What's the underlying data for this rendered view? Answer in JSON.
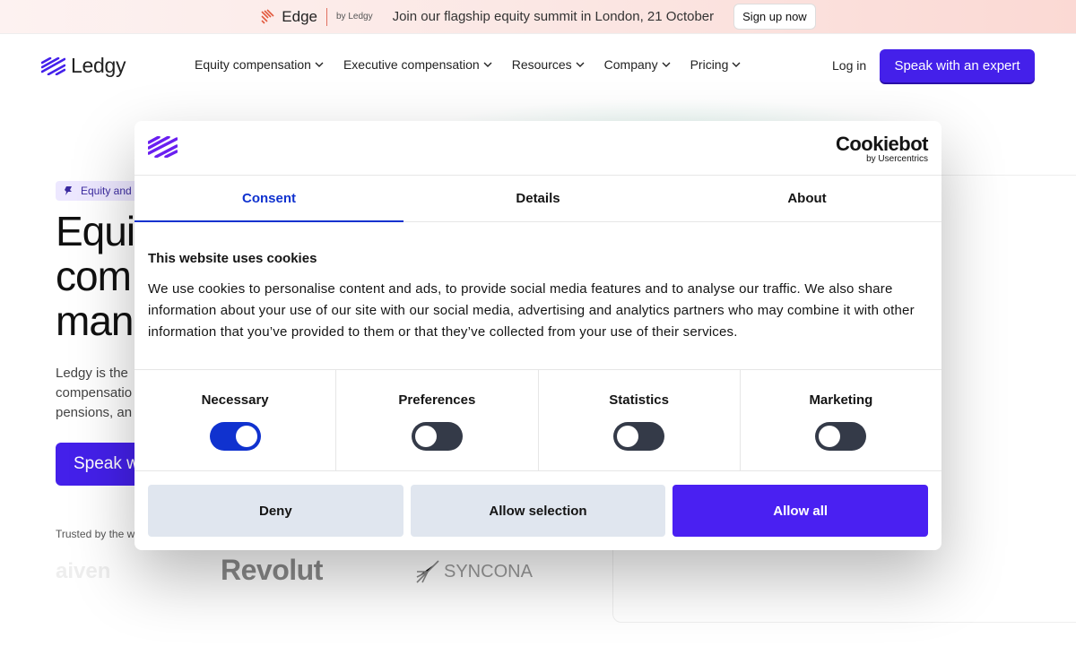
{
  "banner": {
    "edge_word": "Edge",
    "edge_by": "by Ledgy",
    "text": "Join our flagship equity summit in London, 21 October",
    "button": "Sign up now"
  },
  "nav": {
    "logo": "Ledgy",
    "items": [
      "Equity compensation",
      "Executive compensation",
      "Resources",
      "Company",
      "Pricing"
    ],
    "login": "Log in",
    "cta": "Speak with an expert"
  },
  "hero": {
    "badge": "Equity and",
    "title_lines": [
      "Equi",
      "com",
      "man"
    ],
    "desc_lines": [
      "Ledgy is the",
      "compensatio",
      "pensions, an"
    ],
    "cta": "Speak w",
    "trusted": "Trusted by the w",
    "brands": [
      "aiven",
      "Revolut",
      "SYNCONA"
    ]
  },
  "dialog": {
    "brand_name": "Cookiebot",
    "brand_by": "by Usercentrics",
    "tabs": [
      "Consent",
      "Details",
      "About"
    ],
    "heading": "This website uses cookies",
    "body": "We use cookies to personalise content and ads, to provide social media features and to analyse our traffic. We also share information about your use of our site with our social media, advertising and analytics partners who may combine it with other information that you’ve provided to them or that they’ve collected from your use of their services.",
    "toggles": [
      {
        "label": "Necessary",
        "on": true
      },
      {
        "label": "Preferences",
        "on": false
      },
      {
        "label": "Statistics",
        "on": false
      },
      {
        "label": "Marketing",
        "on": false
      }
    ],
    "buttons": {
      "deny": "Deny",
      "selection": "Allow selection",
      "all": "Allow all"
    }
  },
  "colors": {
    "accent": "#4420ea",
    "consent_blue": "#1032cf"
  }
}
